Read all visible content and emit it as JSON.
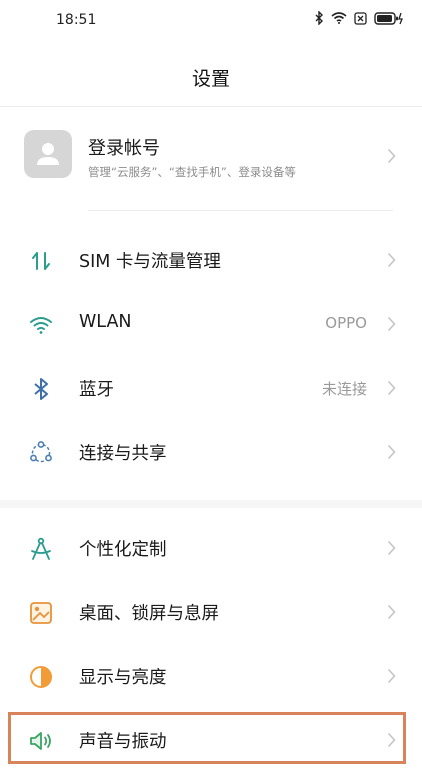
{
  "status_bar": {
    "time": "18:51"
  },
  "header": {
    "title": "设置"
  },
  "account": {
    "title": "登录帐号",
    "subtitle": "管理“云服务”、“查找手机”、登录设备等"
  },
  "group1": [
    {
      "label": "SIM 卡与流量管理",
      "value": "",
      "icon": "sim-data-icon"
    },
    {
      "label": "WLAN",
      "value": "OPPO",
      "icon": "wifi-icon"
    },
    {
      "label": "蓝牙",
      "value": "未连接",
      "icon": "bluetooth-icon"
    },
    {
      "label": "连接与共享",
      "value": "",
      "icon": "share-icon"
    }
  ],
  "group2": [
    {
      "label": "个性化定制",
      "value": "",
      "icon": "compass-icon"
    },
    {
      "label": "桌面、锁屏与息屏",
      "value": "",
      "icon": "wallpaper-icon"
    },
    {
      "label": "显示与亮度",
      "value": "",
      "icon": "brightness-icon"
    },
    {
      "label": "声音与振动",
      "value": "",
      "icon": "speaker-icon"
    }
  ],
  "colors": {
    "accent_teal": "#2a9d8f",
    "highlight_border": "#d9835a",
    "sound_green": "#3aa463",
    "display_orange": "#f29c38"
  }
}
